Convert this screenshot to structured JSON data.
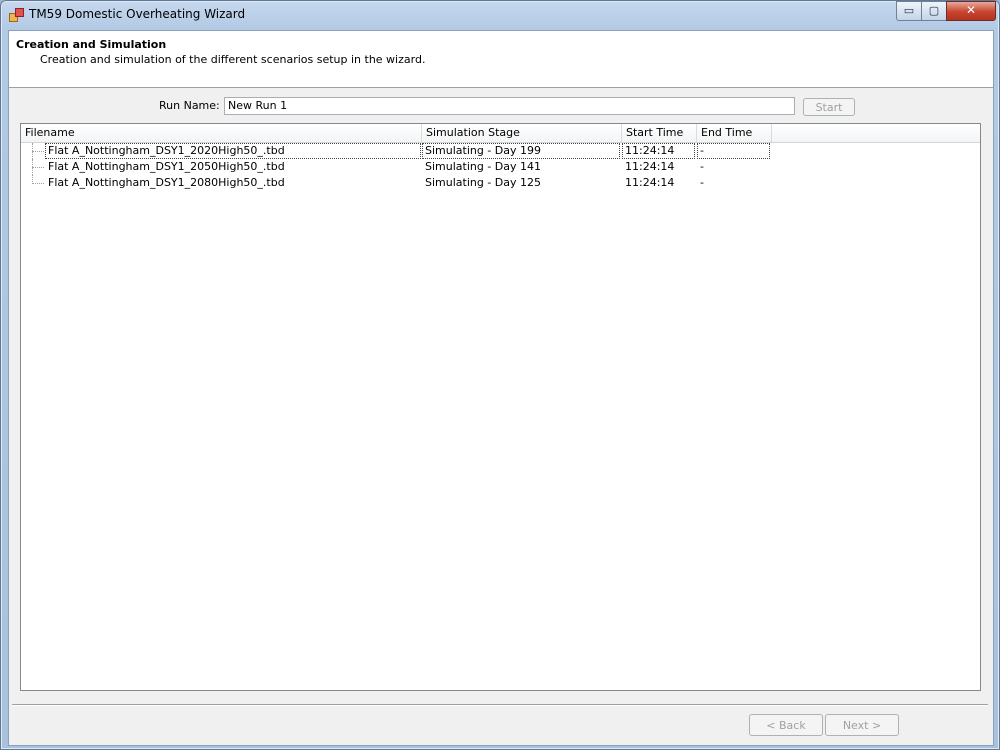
{
  "window": {
    "title": "TM59 Domestic Overheating Wizard",
    "minimize_glyph": "▭",
    "maximize_glyph": "▢",
    "close_glyph": "✕"
  },
  "header": {
    "title": "Creation and Simulation",
    "subtitle": "Creation and simulation of the different scenarios setup in the wizard."
  },
  "run": {
    "label": "Run Name:",
    "value": "New Run 1",
    "start_label": "Start"
  },
  "list": {
    "columns": [
      "Filename",
      "Simulation Stage",
      "Start Time",
      "End Time"
    ],
    "rows": [
      {
        "filename": "Flat A_Nottingham_DSY1_2020High50_.tbd",
        "stage": "Simulating - Day 199",
        "start": "11:24:14",
        "end": "-"
      },
      {
        "filename": "Flat A_Nottingham_DSY1_2050High50_.tbd",
        "stage": "Simulating - Day 141",
        "start": "11:24:14",
        "end": "-"
      },
      {
        "filename": "Flat A_Nottingham_DSY1_2080High50_.tbd",
        "stage": "Simulating - Day 125",
        "start": "11:24:14",
        "end": "-"
      }
    ]
  },
  "footer": {
    "back_label": "< Back",
    "next_label": "Next >"
  },
  "colors": {
    "frame": "#b3cae4",
    "client_bg": "#f0f0f0",
    "disabled_text": "#a0a0a0"
  }
}
